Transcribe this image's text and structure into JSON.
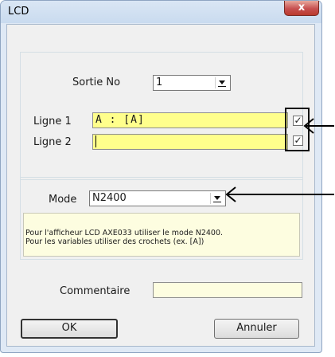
{
  "window": {
    "title": "LCD",
    "close_glyph": "x"
  },
  "output": {
    "label": "Sortie No",
    "value": "1"
  },
  "lines": [
    {
      "label": "Ligne 1",
      "value": "A : [A]",
      "checked": true
    },
    {
      "label": "Ligne 2",
      "value": "",
      "checked": true
    }
  ],
  "checkbox_mark": "✓",
  "mode": {
    "label": "Mode",
    "value": "N2400"
  },
  "info": {
    "line1": "Pour l'afficheur LCD AXE033 utiliser le mode N2400.",
    "line2": "Pour les variables utiliser des crochets (ex. [A])"
  },
  "comment": {
    "label": "Commentaire",
    "value": ""
  },
  "buttons": {
    "ok": "OK",
    "cancel": "Annuler"
  },
  "icons": {
    "close": "close-icon",
    "dropdown": "chevron-down-icon",
    "annotation": "arrow-left-icon"
  }
}
